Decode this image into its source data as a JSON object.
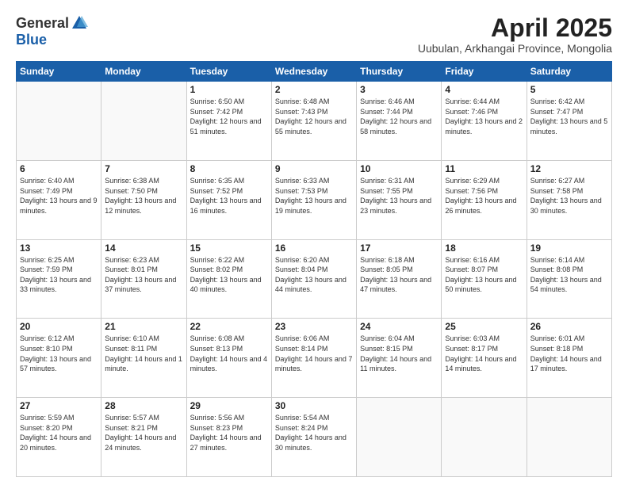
{
  "header": {
    "logo_general": "General",
    "logo_blue": "Blue",
    "month_title": "April 2025",
    "subtitle": "Uubulan, Arkhangai Province, Mongolia"
  },
  "days_of_week": [
    "Sunday",
    "Monday",
    "Tuesday",
    "Wednesday",
    "Thursday",
    "Friday",
    "Saturday"
  ],
  "weeks": [
    [
      {
        "day": "",
        "info": ""
      },
      {
        "day": "",
        "info": ""
      },
      {
        "day": "1",
        "info": "Sunrise: 6:50 AM\nSunset: 7:42 PM\nDaylight: 12 hours and 51 minutes."
      },
      {
        "day": "2",
        "info": "Sunrise: 6:48 AM\nSunset: 7:43 PM\nDaylight: 12 hours and 55 minutes."
      },
      {
        "day": "3",
        "info": "Sunrise: 6:46 AM\nSunset: 7:44 PM\nDaylight: 12 hours and 58 minutes."
      },
      {
        "day": "4",
        "info": "Sunrise: 6:44 AM\nSunset: 7:46 PM\nDaylight: 13 hours and 2 minutes."
      },
      {
        "day": "5",
        "info": "Sunrise: 6:42 AM\nSunset: 7:47 PM\nDaylight: 13 hours and 5 minutes."
      }
    ],
    [
      {
        "day": "6",
        "info": "Sunrise: 6:40 AM\nSunset: 7:49 PM\nDaylight: 13 hours and 9 minutes."
      },
      {
        "day": "7",
        "info": "Sunrise: 6:38 AM\nSunset: 7:50 PM\nDaylight: 13 hours and 12 minutes."
      },
      {
        "day": "8",
        "info": "Sunrise: 6:35 AM\nSunset: 7:52 PM\nDaylight: 13 hours and 16 minutes."
      },
      {
        "day": "9",
        "info": "Sunrise: 6:33 AM\nSunset: 7:53 PM\nDaylight: 13 hours and 19 minutes."
      },
      {
        "day": "10",
        "info": "Sunrise: 6:31 AM\nSunset: 7:55 PM\nDaylight: 13 hours and 23 minutes."
      },
      {
        "day": "11",
        "info": "Sunrise: 6:29 AM\nSunset: 7:56 PM\nDaylight: 13 hours and 26 minutes."
      },
      {
        "day": "12",
        "info": "Sunrise: 6:27 AM\nSunset: 7:58 PM\nDaylight: 13 hours and 30 minutes."
      }
    ],
    [
      {
        "day": "13",
        "info": "Sunrise: 6:25 AM\nSunset: 7:59 PM\nDaylight: 13 hours and 33 minutes."
      },
      {
        "day": "14",
        "info": "Sunrise: 6:23 AM\nSunset: 8:01 PM\nDaylight: 13 hours and 37 minutes."
      },
      {
        "day": "15",
        "info": "Sunrise: 6:22 AM\nSunset: 8:02 PM\nDaylight: 13 hours and 40 minutes."
      },
      {
        "day": "16",
        "info": "Sunrise: 6:20 AM\nSunset: 8:04 PM\nDaylight: 13 hours and 44 minutes."
      },
      {
        "day": "17",
        "info": "Sunrise: 6:18 AM\nSunset: 8:05 PM\nDaylight: 13 hours and 47 minutes."
      },
      {
        "day": "18",
        "info": "Sunrise: 6:16 AM\nSunset: 8:07 PM\nDaylight: 13 hours and 50 minutes."
      },
      {
        "day": "19",
        "info": "Sunrise: 6:14 AM\nSunset: 8:08 PM\nDaylight: 13 hours and 54 minutes."
      }
    ],
    [
      {
        "day": "20",
        "info": "Sunrise: 6:12 AM\nSunset: 8:10 PM\nDaylight: 13 hours and 57 minutes."
      },
      {
        "day": "21",
        "info": "Sunrise: 6:10 AM\nSunset: 8:11 PM\nDaylight: 14 hours and 1 minute."
      },
      {
        "day": "22",
        "info": "Sunrise: 6:08 AM\nSunset: 8:13 PM\nDaylight: 14 hours and 4 minutes."
      },
      {
        "day": "23",
        "info": "Sunrise: 6:06 AM\nSunset: 8:14 PM\nDaylight: 14 hours and 7 minutes."
      },
      {
        "day": "24",
        "info": "Sunrise: 6:04 AM\nSunset: 8:15 PM\nDaylight: 14 hours and 11 minutes."
      },
      {
        "day": "25",
        "info": "Sunrise: 6:03 AM\nSunset: 8:17 PM\nDaylight: 14 hours and 14 minutes."
      },
      {
        "day": "26",
        "info": "Sunrise: 6:01 AM\nSunset: 8:18 PM\nDaylight: 14 hours and 17 minutes."
      }
    ],
    [
      {
        "day": "27",
        "info": "Sunrise: 5:59 AM\nSunset: 8:20 PM\nDaylight: 14 hours and 20 minutes."
      },
      {
        "day": "28",
        "info": "Sunrise: 5:57 AM\nSunset: 8:21 PM\nDaylight: 14 hours and 24 minutes."
      },
      {
        "day": "29",
        "info": "Sunrise: 5:56 AM\nSunset: 8:23 PM\nDaylight: 14 hours and 27 minutes."
      },
      {
        "day": "30",
        "info": "Sunrise: 5:54 AM\nSunset: 8:24 PM\nDaylight: 14 hours and 30 minutes."
      },
      {
        "day": "",
        "info": ""
      },
      {
        "day": "",
        "info": ""
      },
      {
        "day": "",
        "info": ""
      }
    ]
  ]
}
